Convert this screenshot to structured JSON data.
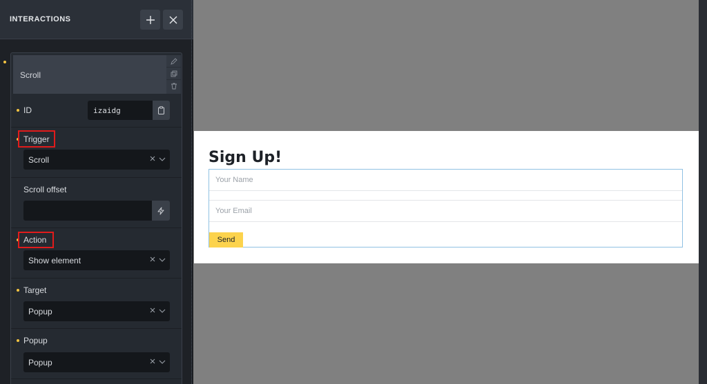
{
  "panel": {
    "title": "INTERACTIONS",
    "add_icon": "plus-icon",
    "close_icon": "close-icon"
  },
  "interaction": {
    "header_label": "Scroll",
    "tools": [
      "pencil-icon",
      "copy-icon",
      "trash-icon"
    ],
    "id": {
      "label": "ID",
      "value": "izaidg",
      "copy_icon": "clipboard-icon"
    },
    "trigger": {
      "label": "Trigger",
      "value": "Scroll"
    },
    "scroll_offset": {
      "label": "Scroll offset",
      "value": "",
      "icon": "bolt-icon"
    },
    "action": {
      "label": "Action",
      "value": "Show element"
    },
    "target": {
      "label": "Target",
      "value": "Popup"
    },
    "popup": {
      "label": "Popup",
      "value": "Popup"
    }
  },
  "preview": {
    "title": "Sign Up!",
    "name_placeholder": "Your Name",
    "email_placeholder": "Your Email",
    "send_label": "Send"
  },
  "colors": {
    "accent_dot": "#f5c542",
    "highlight": "#e21b1b",
    "send_button": "#fcd34d",
    "form_border": "#8fc1e3"
  }
}
